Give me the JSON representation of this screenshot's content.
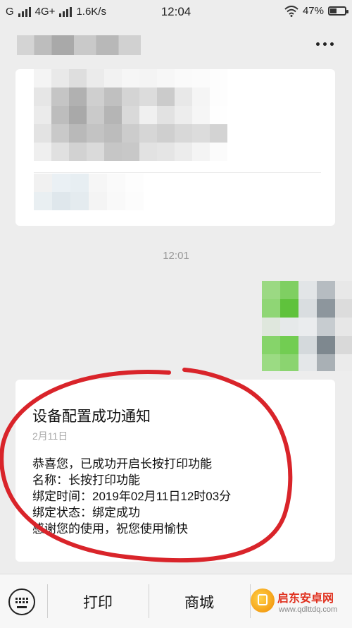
{
  "status_bar": {
    "carrier1": "G",
    "carrier2": "4G+",
    "speed": "1.6K/s",
    "time": "12:04",
    "battery": "47%",
    "battery_level": 0.47
  },
  "header": {
    "more_icon": "more-dots-icon"
  },
  "chat": {
    "timestamp": "12:01",
    "notification": {
      "title": "设备配置成功通知",
      "date": "2月11日",
      "lines": [
        "恭喜您，已成功开启长按打印功能",
        "名称：长按打印功能",
        "绑定时间：2019年02月11日12时03分",
        "绑定状态：绑定成功",
        "感谢您的使用，祝您使用愉快"
      ]
    }
  },
  "bottom_bar": {
    "keyboard_icon": "keyboard-icon",
    "tabs": [
      "打印",
      "商城"
    ]
  },
  "watermark": {
    "name": "启东安卓网",
    "url": "www.qdlttdq.com"
  },
  "colors": {
    "annotation": "#d9242a",
    "background": "#ededed"
  }
}
